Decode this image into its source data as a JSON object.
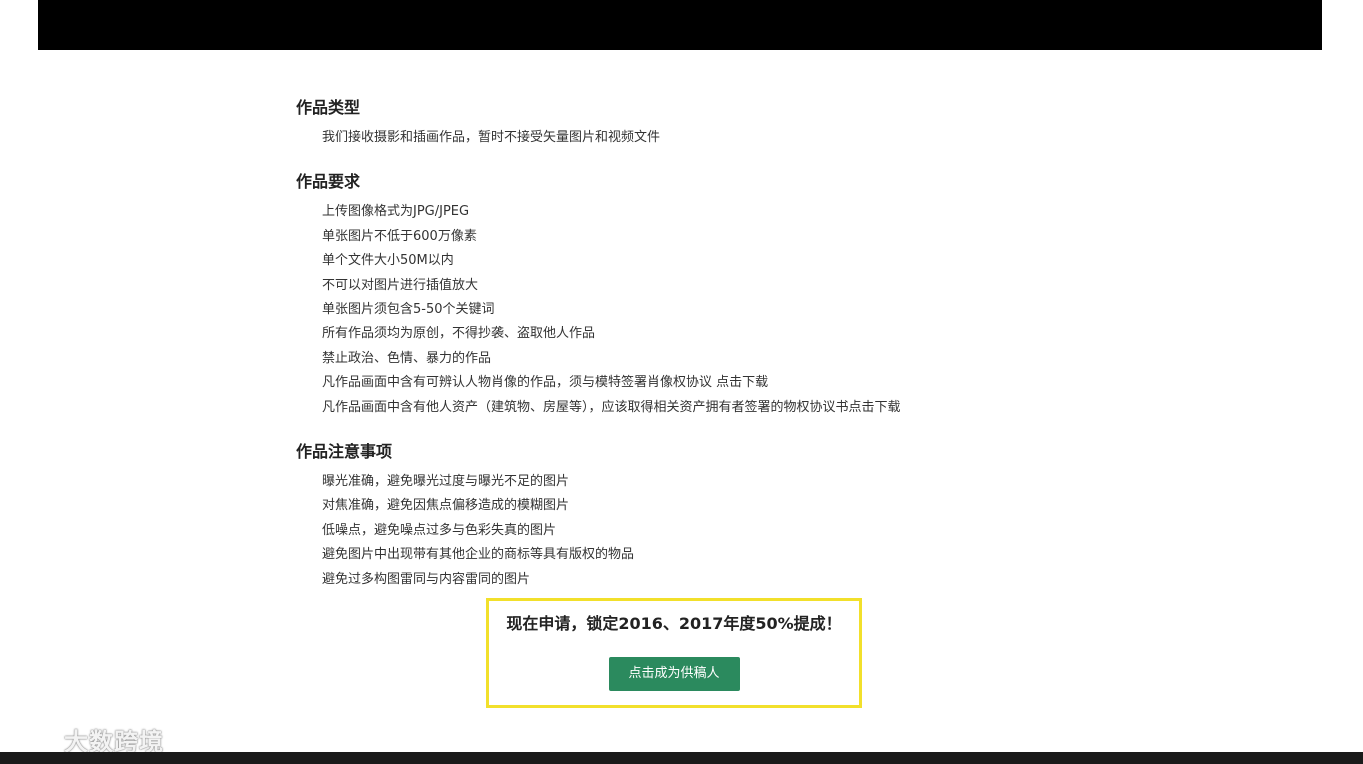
{
  "sections": [
    {
      "title": "作品类型",
      "items": [
        "我们接收摄影和插画作品，暂时不接受矢量图片和视频文件"
      ]
    },
    {
      "title": "作品要求",
      "items": [
        "上传图像格式为JPG/JPEG",
        "单张图片不低于600万像素",
        "单个文件大小50M以内",
        "不可以对图片进行插值放大",
        "单张图片须包含5-50个关键词",
        "所有作品须均为原创，不得抄袭、盗取他人作品",
        "禁止政治、色情、暴力的作品",
        "凡作品画面中含有可辨认人物肖像的作品，须与模特签署肖像权协议 点击下载",
        "凡作品画面中含有他人资产（建筑物、房屋等），应该取得相关资产拥有者签署的物权协议书点击下载"
      ]
    },
    {
      "title": "作品注意事项",
      "items": [
        "曝光准确，避免曝光过度与曝光不足的图片",
        "对焦准确，避免因焦点偏移造成的模糊图片",
        "低噪点，避免噪点过多与色彩失真的图片",
        "避免图片中出现带有其他企业的商标等具有版权的物品",
        "避免过多构图雷同与内容雷同的图片"
      ]
    }
  ],
  "cta": {
    "headline": "现在申请，锁定2016、2017年度50%提成！",
    "button_label": "点击成为供稿人"
  },
  "watermark": {
    "text": "大数跨境"
  },
  "colors": {
    "cta_border": "#f2e02b",
    "cta_button": "#2b8a5e",
    "top_bar": "#000000"
  }
}
